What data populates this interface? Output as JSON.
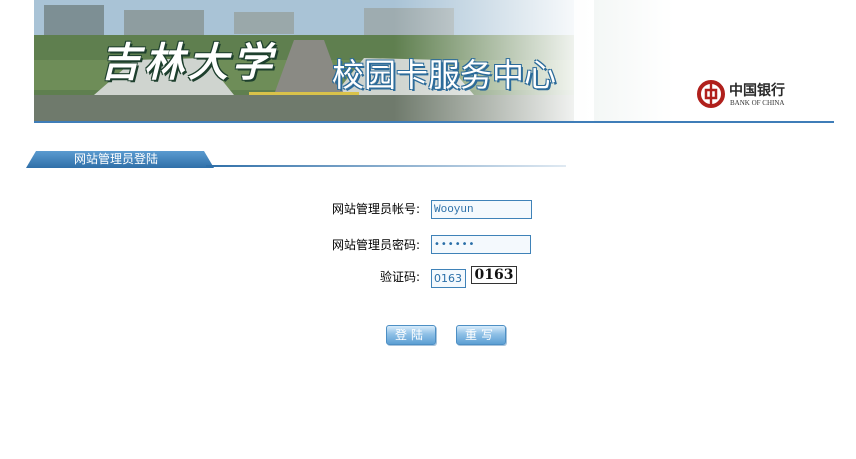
{
  "banner": {
    "school_name": "吉林大学",
    "title": "校园卡服务中心",
    "bank_name_cn": "中国银行",
    "bank_name_en": "BANK OF CHINA"
  },
  "section": {
    "title": "网站管理员登陆"
  },
  "form": {
    "username_label": "网站管理员帐号:",
    "username_value": "Wooyun",
    "password_label": "网站管理员密码:",
    "password_value": "••••••",
    "captcha_label": "验证码:",
    "captcha_value": "0163",
    "captcha_image_text": "0163"
  },
  "buttons": {
    "login": "登陆",
    "reset": "重写"
  },
  "colors": {
    "accent": "#2f6fa8",
    "field_border": "#3f82b8"
  }
}
